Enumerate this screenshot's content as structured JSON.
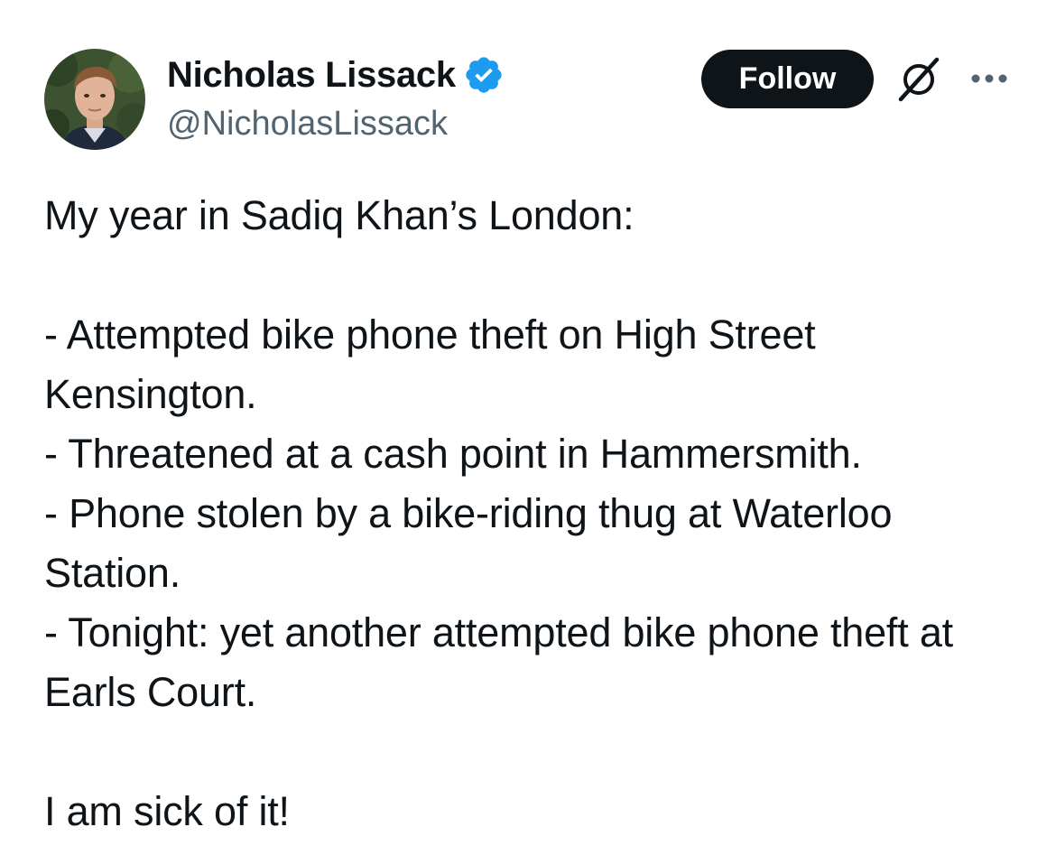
{
  "author": {
    "display_name": "Nicholas Lissack",
    "handle": "@NicholasLissack",
    "verified": true
  },
  "actions": {
    "follow_label": "Follow"
  },
  "icons": {
    "verified": "verified-badge-icon",
    "grok": "grok-icon",
    "more": "more-dots-icon"
  },
  "tweet": {
    "text": "My year in Sadiq Khan’s London:\n\n- Attempted bike phone theft on High Street Kensington.\n- Threatened at a cash point in Hammersmith.\n- Phone stolen by a bike-riding thug at Waterloo Station.\n- Tonight: yet another attempted bike phone theft at Earls Court.\n\nI am sick of it!"
  },
  "colors": {
    "verified_blue": "#1d9bf0",
    "follow_bg": "#0f1419",
    "handle_gray": "#536471",
    "text": "#0f1419"
  }
}
